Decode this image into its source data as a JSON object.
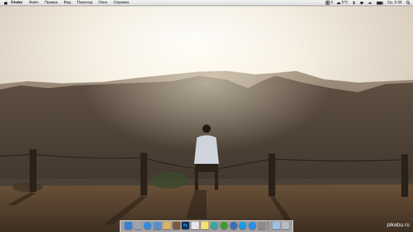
{
  "menubar": {
    "app_name": "Finder",
    "items": [
      "Файл",
      "Правка",
      "Вид",
      "Переход",
      "Окно",
      "Справка"
    ],
    "status": {
      "battery_label": "3",
      "keyboard_layout": "5°C",
      "clock": "Ср. 0:36"
    }
  },
  "dock": {
    "apps": [
      {
        "name": "Finder",
        "icon": "finder-icon",
        "color": "#3a7fd8"
      },
      {
        "name": "Launchpad",
        "icon": "launchpad-icon",
        "color": "#9aa4b4"
      },
      {
        "name": "Safari",
        "icon": "safari-icon",
        "color": "#2d8fe0"
      },
      {
        "name": "Preview",
        "icon": "preview-icon",
        "color": "#5c8fc7"
      },
      {
        "name": "Documents",
        "icon": "documents-icon",
        "color": "#d9b46a"
      },
      {
        "name": "iPhoto",
        "icon": "iphoto-icon",
        "color": "#7a5a3c"
      },
      {
        "name": "Photoshop",
        "icon": "photoshop-icon",
        "color": "#10305a",
        "text": "Ps"
      },
      {
        "name": "Calendar",
        "icon": "calendar-icon",
        "color": "#e6e6e6"
      },
      {
        "name": "Stickies",
        "icon": "stickies-icon",
        "color": "#f3e36a"
      },
      {
        "name": "Game",
        "icon": "game-icon",
        "color": "#3aa7a0"
      },
      {
        "name": "uTorrent",
        "icon": "utorrent-icon",
        "color": "#3c9c2e"
      },
      {
        "name": "Internet",
        "icon": "globe-icon",
        "color": "#3f6fb0"
      },
      {
        "name": "Skype",
        "icon": "skype-icon",
        "color": "#1c9be0"
      },
      {
        "name": "App Store",
        "icon": "appstore-icon",
        "color": "#2a8fe6"
      },
      {
        "name": "System Preferences",
        "icon": "settings-icon",
        "color": "#8c8c8c"
      },
      {
        "name": "Downloads",
        "icon": "downloads-icon",
        "color": "#9cc0e6"
      },
      {
        "name": "Trash",
        "icon": "trash-icon",
        "color": "#b9bcc2"
      }
    ]
  },
  "watermark": "pikabu.ru",
  "colors": {
    "sky": "#f6f1e6",
    "mountains_far": "#8c7c6c",
    "mountains_near": "#4b3f34",
    "ground": "#5a4632"
  }
}
